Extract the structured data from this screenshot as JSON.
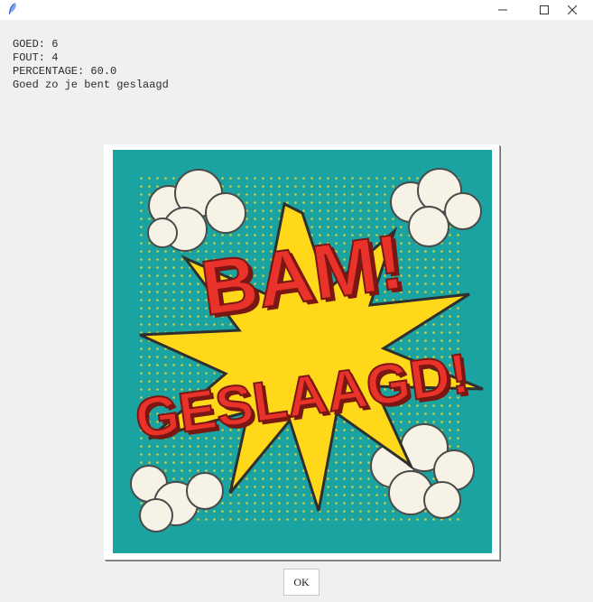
{
  "window": {
    "title": "",
    "icons": {
      "app": "feather-icon",
      "minimize": "minimize-icon",
      "maximize": "maximize-icon",
      "close": "close-icon"
    }
  },
  "stats": {
    "good": "GOED: 6",
    "wrong": "FOUT: 4",
    "percentage": "PERCENTAGE: 60.0",
    "message": "Goed zo je bent geslaagd"
  },
  "image": {
    "line1": "BAM!",
    "line2": "GESLAAGD!",
    "colors": {
      "background": "#1ba3a1",
      "burst": "#ffd81a",
      "text": "#e8322a",
      "text_shadow": "#7a1712",
      "cloud": "#f6f3e6"
    }
  },
  "actions": {
    "ok_label": "OK"
  }
}
